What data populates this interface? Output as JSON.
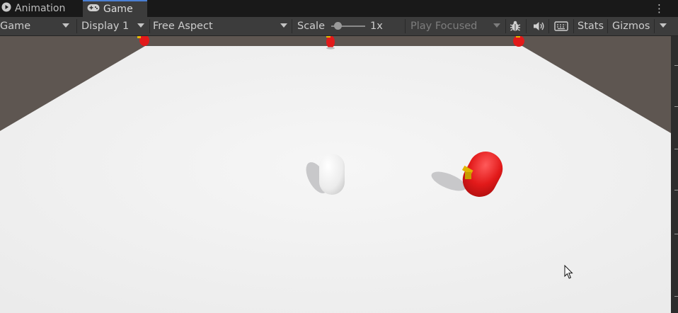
{
  "tabs": [
    {
      "label": "Animation",
      "icon": "play-icon"
    },
    {
      "label": "Game",
      "icon": "gamepad-icon",
      "active": true
    }
  ],
  "toolbar": {
    "display_type": "Game",
    "display": "Display 1",
    "aspect": "Free Aspect",
    "scale_label": "Scale",
    "scale_value": "1x",
    "scale_level": 0.1,
    "play_mode": "Play Focused",
    "stats": "Stats",
    "gizmos": "Gizmos"
  },
  "colors": {
    "tab_accent": "#4a7fd4",
    "toolbar_bg": "#3c3c3c",
    "floor": "#f1f1f1",
    "background_wall": "#5e5651",
    "enemy": "#e21a1a",
    "player": "#f2f2f2"
  }
}
